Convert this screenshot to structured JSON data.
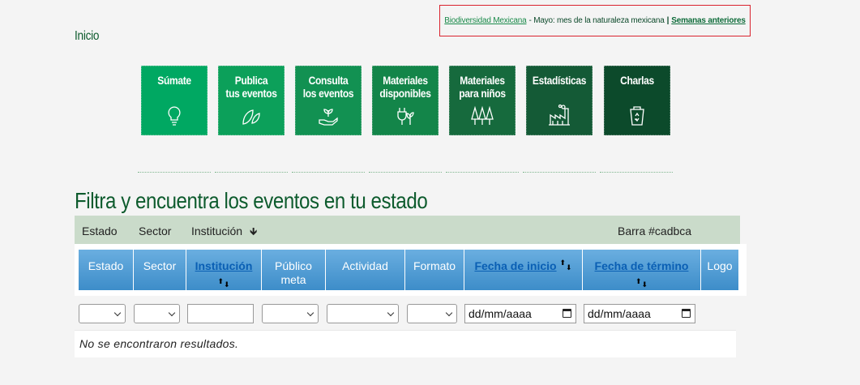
{
  "notice": {
    "link1": "Biodiversidad Mexicana",
    "text": "- Mayo: mes de la naturaleza mexicana",
    "sep": "|",
    "link2": "Semanas anteriores"
  },
  "nav": {
    "inicio": "Inicio"
  },
  "tiles": [
    {
      "line1": "Súmate",
      "line2": "",
      "icon": "lightbulb-icon",
      "color": "#00a862"
    },
    {
      "line1": "Publica",
      "line2": "tus eventos",
      "icon": "leaves-icon",
      "color": "#0ca05a"
    },
    {
      "line1": "Consulta",
      "line2": "los eventos",
      "icon": "hand-plant-icon",
      "color": "#129152"
    },
    {
      "line1": "Materiales",
      "line2": "disponibles",
      "icon": "plug-leaf-icon",
      "color": "#138549"
    },
    {
      "line1": "Materiales",
      "line2": "para niños",
      "icon": "trees-icon",
      "color": "#166a3d"
    },
    {
      "line1": "Estadísticas",
      "line2": "",
      "icon": "factory-icon",
      "color": "#145a36"
    },
    {
      "line1": "Charlas",
      "line2": "",
      "icon": "recycle-bin-icon",
      "color": "#0c4a2b"
    }
  ],
  "title": "Filtra y encuentra los eventos en tu estado",
  "bar": {
    "estado": "Estado",
    "sector": "Sector",
    "institucion": "Institución",
    "sort_glyph": "🡻",
    "note": "Barra #cadbca"
  },
  "table": {
    "headers": [
      "Estado",
      "Sector",
      "Institución",
      "Público meta",
      "Actividad",
      "Formato",
      "Fecha de inicio",
      "Fecha de término",
      "Logo"
    ],
    "sort_up": "⬆",
    "sort_down": "⬇"
  },
  "filters": {
    "date_placeholder": "dd/mm/aaaa"
  },
  "empty_message": "No se encontraron resultados.",
  "colors": {
    "header_blue": "#4d9ad6",
    "bar_green": "#cadbca",
    "title_green": "#0d5b2d",
    "notice_border": "#d9232e"
  }
}
